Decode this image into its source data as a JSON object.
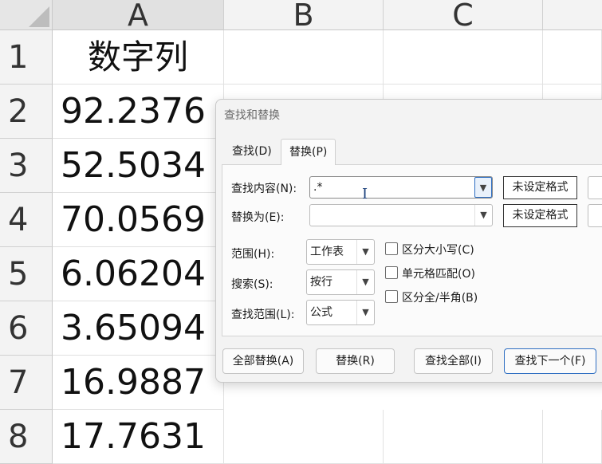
{
  "sheet": {
    "columns": [
      "A",
      "B",
      "C"
    ],
    "rows": [
      "1",
      "2",
      "3",
      "4",
      "5",
      "6",
      "7",
      "8"
    ],
    "cells": {
      "a1": "数字列",
      "a2": "92.2376",
      "a3": "52.5034",
      "a4": "70.0569",
      "a5": "6.06204",
      "a6": "3.65094",
      "a7": "16.9887",
      "a8": "17.7631"
    }
  },
  "dialog": {
    "title": "查找和替换",
    "tabs": [
      {
        "label": "查找(D)",
        "active": false
      },
      {
        "label": "替换(P)",
        "active": true
      }
    ],
    "find": {
      "label": "查找内容(N):",
      "value": ".*",
      "format_label": "未设定格式"
    },
    "replace": {
      "label": "替换为(E):",
      "value": "",
      "format_label": "未设定格式"
    },
    "scope": {
      "label": "范围(H):",
      "value": "工作表"
    },
    "search": {
      "label": "搜索(S):",
      "value": "按行"
    },
    "look_in": {
      "label": "查找范围(L):",
      "value": "公式"
    },
    "options": {
      "match_case": {
        "label": "区分大小写(C)",
        "checked": false
      },
      "match_cell": {
        "label": "单元格匹配(O)",
        "checked": false
      },
      "match_width": {
        "label": "区分全/半角(B)",
        "checked": false
      }
    },
    "buttons": {
      "replace_all": "全部替换(A)",
      "replace": "替换(R)",
      "find_all": "查找全部(I)",
      "find_next": "查找下一个(F)"
    },
    "colors": {
      "accent": "#2f6fc2"
    }
  }
}
